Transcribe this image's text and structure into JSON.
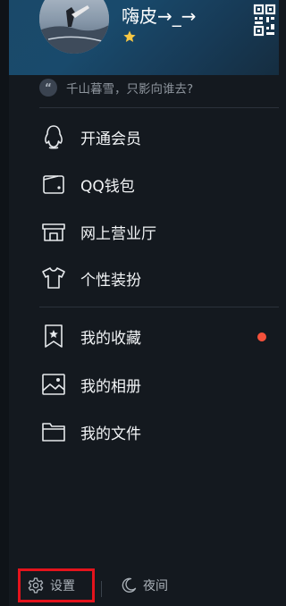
{
  "profile": {
    "nickname": "嗨皮→_→",
    "signature_quote": "“",
    "signature": "千山暮雪，只影向谁去?"
  },
  "menu": [
    {
      "label": "开通会员",
      "icon": "penguin-icon"
    },
    {
      "label": "QQ钱包",
      "icon": "wallet-icon"
    },
    {
      "label": "网上营业厅",
      "icon": "store-icon"
    },
    {
      "label": "个性装扮",
      "icon": "tshirt-icon"
    },
    {
      "label": "我的收藏",
      "icon": "bookmark-star-icon",
      "badge_color": "#f4513b"
    },
    {
      "label": "我的相册",
      "icon": "picture-icon"
    },
    {
      "label": "我的文件",
      "icon": "folder-icon"
    }
  ],
  "bottom": {
    "settings_label": "设置",
    "night_label": "夜间"
  },
  "colors": {
    "highlight_border": "#e4131c",
    "badge": "#f4513b"
  }
}
